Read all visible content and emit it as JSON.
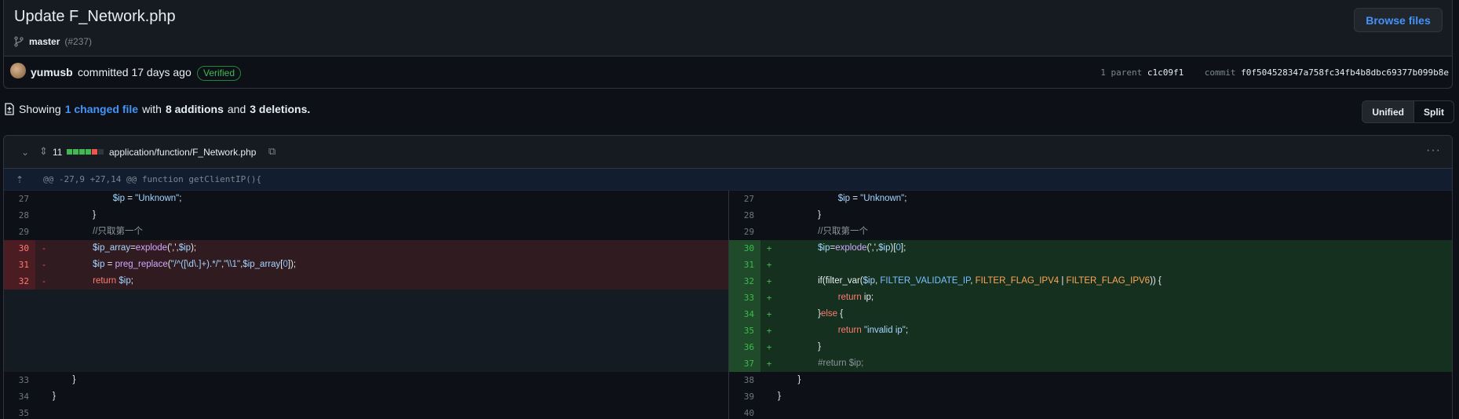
{
  "commit": {
    "title": "Update F_Network.php",
    "branch": "master",
    "pr_ref": "(#237)",
    "browse_label": "Browse files",
    "author": "yumusb",
    "committed_text": "committed 17 days ago",
    "verified_label": "Verified",
    "parent_label": "1 parent",
    "parent_sha": "c1c09f1",
    "commit_label": "commit",
    "commit_sha": "f0f504528347a758fc34fb4b8dbc69377b099b8e"
  },
  "summary": {
    "showing": "Showing",
    "changed": "1 changed file",
    "with": "with",
    "additions": "8 additions",
    "and": "and",
    "deletions": "3 deletions.",
    "view_unified": "Unified",
    "view_split": "Split"
  },
  "file": {
    "change_count": "11",
    "path": "application/function/F_Network.php",
    "bars": [
      "#3fb950",
      "#3fb950",
      "#3fb950",
      "#3fb950",
      "#f85149",
      "#30363d"
    ],
    "colors": {
      "addition": "#3fb950",
      "deletion": "#f85149",
      "link": "#4493f8"
    }
  },
  "hunk_header": "@@ -27,9 +27,14 @@ function getClientIP(){",
  "left_lines": [
    {
      "num": "27",
      "type": "ctx",
      "sign": "",
      "code": "                        $ip = \"Unknown\";"
    },
    {
      "num": "28",
      "type": "ctx",
      "sign": "",
      "code": "                }"
    },
    {
      "num": "29",
      "type": "ctx",
      "sign": "",
      "code": "                //只取第一个"
    },
    {
      "num": "30",
      "type": "del",
      "sign": "-",
      "code": "                $ip_array=explode(',',$ip);"
    },
    {
      "num": "31",
      "type": "del",
      "sign": "-",
      "code": "                $ip = preg_replace(\"/^([\\d\\.]+).*/\",\"\\\\1\",$ip_array[0]);"
    },
    {
      "num": "32",
      "type": "del",
      "sign": "-",
      "code": "                return $ip;"
    },
    {
      "num": "",
      "type": "empty",
      "sign": "",
      "code": ""
    },
    {
      "num": "",
      "type": "empty",
      "sign": "",
      "code": ""
    },
    {
      "num": "",
      "type": "empty",
      "sign": "",
      "code": ""
    },
    {
      "num": "",
      "type": "empty",
      "sign": "",
      "code": ""
    },
    {
      "num": "",
      "type": "empty",
      "sign": "",
      "code": ""
    },
    {
      "num": "33",
      "type": "ctx",
      "sign": "",
      "code": "        }"
    },
    {
      "num": "34",
      "type": "ctx",
      "sign": "",
      "code": "}"
    },
    {
      "num": "35",
      "type": "ctx",
      "sign": "",
      "code": ""
    }
  ],
  "right_lines": [
    {
      "num": "27",
      "type": "ctx",
      "sign": "",
      "code": "                        $ip = \"Unknown\";"
    },
    {
      "num": "28",
      "type": "ctx",
      "sign": "",
      "code": "                }"
    },
    {
      "num": "29",
      "type": "ctx",
      "sign": "",
      "code": "                //只取第一个"
    },
    {
      "num": "30",
      "type": "add",
      "sign": "+",
      "code": "                $ip=explode(',',$ip)[0];"
    },
    {
      "num": "31",
      "type": "add",
      "sign": "+",
      "code": ""
    },
    {
      "num": "32",
      "type": "add",
      "sign": "+",
      "code": "                if(filter_var($ip, FILTER_VALIDATE_IP, FILTER_FLAG_IPV4 | FILTER_FLAG_IPV6)) {"
    },
    {
      "num": "33",
      "type": "add",
      "sign": "+",
      "code": "                        return ip;"
    },
    {
      "num": "34",
      "type": "add",
      "sign": "+",
      "code": "                }else {"
    },
    {
      "num": "35",
      "type": "add",
      "sign": "+",
      "code": "                        return \"invalid ip\";"
    },
    {
      "num": "36",
      "type": "add",
      "sign": "+",
      "code": "                }"
    },
    {
      "num": "37",
      "type": "add",
      "sign": "+",
      "code": "                #return $ip;"
    },
    {
      "num": "38",
      "type": "ctx",
      "sign": "",
      "code": "        }"
    },
    {
      "num": "39",
      "type": "ctx",
      "sign": "",
      "code": "}"
    },
    {
      "num": "40",
      "type": "ctx",
      "sign": "",
      "code": ""
    }
  ]
}
